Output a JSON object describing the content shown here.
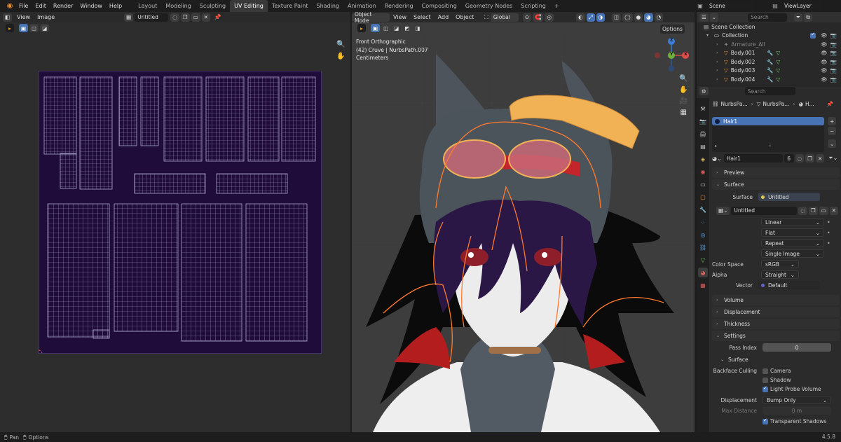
{
  "topbar": {
    "menus": [
      "File",
      "Edit",
      "Render",
      "Window",
      "Help"
    ],
    "workspaces": [
      "Layout",
      "Modeling",
      "Sculpting",
      "UV Editing",
      "Texture Paint",
      "Shading",
      "Animation",
      "Rendering",
      "Compositing",
      "Geometry Nodes",
      "Scripting"
    ],
    "add_tab": "+",
    "scene": "Scene",
    "view_layer": "ViewLayer"
  },
  "uv_editor": {
    "menus": [
      "View",
      "Image"
    ],
    "image_name": "Untitled"
  },
  "viewport": {
    "mode": "Object Mode",
    "menus": [
      "View",
      "Select",
      "Add",
      "Object"
    ],
    "transform_orientation": "Global",
    "options_label": "Options",
    "overlay_lines": [
      "Front Orthographic",
      "(42) Cruve | NurbsPath.007",
      "Centimeters"
    ],
    "gizmo": {
      "z": "Z",
      "y": "Y",
      "x": "X"
    }
  },
  "outliner": {
    "search_placeholder": "Search",
    "scene_collection": "Scene Collection",
    "collection": "Collection",
    "items": [
      "Armature_All",
      "Body.001",
      "Body.002",
      "Body.003",
      "Body.004"
    ]
  },
  "properties": {
    "search_placeholder": "Search",
    "breadcrumb": [
      "NurbsPa...",
      "NurbsPa...",
      "H..."
    ],
    "material_slot": "Hair1",
    "material_name": "Hair1",
    "user_count": "6",
    "panels": {
      "preview": "Preview",
      "surface": "Surface",
      "volume": "Volume",
      "displacement": "Displacement",
      "thickness": "Thickness",
      "settings": "Settings",
      "settings_surface": "Surface"
    },
    "surface_label": "Surface",
    "surface_value": "Untitled",
    "image_name": "Untitled",
    "interpolation": "Linear",
    "projection": "Flat",
    "extension": "Repeat",
    "source": "Single Image",
    "color_space_label": "Color Space",
    "color_space": "sRGB",
    "alpha_label": "Alpha",
    "alpha": "Straight",
    "vector_label": "Vector",
    "vector": "Default",
    "pass_index_label": "Pass Index",
    "pass_index": "0",
    "backface_label": "Backface Culling",
    "camera": "Camera",
    "shadow": "Shadow",
    "light_probe": "Light Probe Volume",
    "displacement_label": "Displacement",
    "displacement": "Bump Only",
    "max_distance_label": "Max Distance",
    "max_distance": "0 m",
    "transparent_shadows": "Transparent Shadows"
  },
  "statusbar": {
    "pan": "Pan",
    "options": "Options",
    "version": "4.5.8"
  },
  "colors": {
    "accent": "#4772b3",
    "uv_bg": "#1f0c3b",
    "outline": "#ff7a2e"
  }
}
